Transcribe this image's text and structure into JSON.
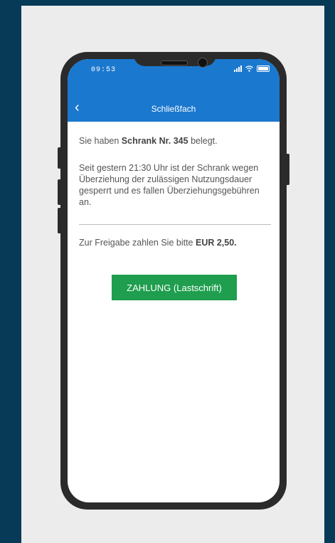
{
  "status_bar": {
    "time": "09:53"
  },
  "nav": {
    "back_label": "‹",
    "title": "Schließfach"
  },
  "content": {
    "line1_prefix": "Sie haben ",
    "line1_bold": "Schrank Nr. 345",
    "line1_suffix": " belegt.",
    "paragraph2": "Seit gestern 21:30 Uhr ist der Schrank wegen Überziehung der zulässigen Nutzungsdauer gesperrt und es fallen Überziehungsgebühren an.",
    "line3_prefix": "Zur Freigabe zahlen Sie bitte ",
    "line3_bold": "EUR 2,50."
  },
  "actions": {
    "pay_label": "ZAHLUNG (Lastschrift)"
  },
  "colors": {
    "header": "#1b78cf",
    "button": "#1e9e4e",
    "background": "#073a57"
  }
}
